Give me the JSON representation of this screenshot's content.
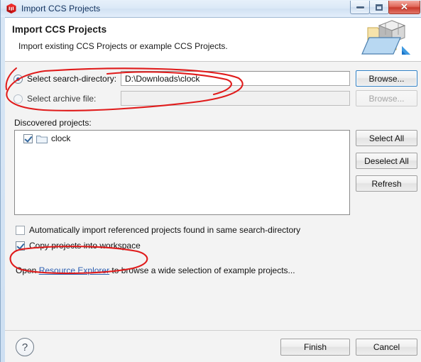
{
  "window": {
    "title": "Import CCS Projects",
    "icon": "ccs-cube-icon",
    "controls": {
      "minimize": "–",
      "maximize": "□",
      "close": "✕"
    }
  },
  "header": {
    "title": "Import CCS Projects",
    "subtitle": "Import existing CCS Projects or example CCS Projects.",
    "banner_icon": "import-folder-cube-icon"
  },
  "source": {
    "search_directory": {
      "label": "Select search-directory:",
      "selected": true,
      "value": "D:\\Downloads\\clock",
      "placeholder": "",
      "browse_label": "Browse..."
    },
    "archive_file": {
      "label": "Select archive file:",
      "selected": false,
      "value": "",
      "placeholder": "",
      "browse_label": "Browse...",
      "disabled": true
    }
  },
  "discovered": {
    "label": "Discovered projects:",
    "items": [
      {
        "name": "clock",
        "checked": true,
        "icon": "folder-icon"
      }
    ],
    "buttons": {
      "select_all": "Select All",
      "deselect_all": "Deselect All",
      "refresh": "Refresh"
    }
  },
  "options": {
    "auto_import": {
      "label": "Automatically import referenced projects found in same search-directory",
      "checked": false
    },
    "copy_projects": {
      "label": "Copy projects into workspace",
      "checked": true
    }
  },
  "resource_link": {
    "prefix": "Open ",
    "link_text": "Resource Explorer",
    "suffix": " to browse a wide selection of example projects..."
  },
  "footer": {
    "help": "?",
    "finish": "Finish",
    "cancel": "Cancel"
  },
  "colors": {
    "accent": "#2a6fb5",
    "link": "#2a5db0",
    "annotation": "#e01b1b",
    "close_button": "#c9392c"
  }
}
